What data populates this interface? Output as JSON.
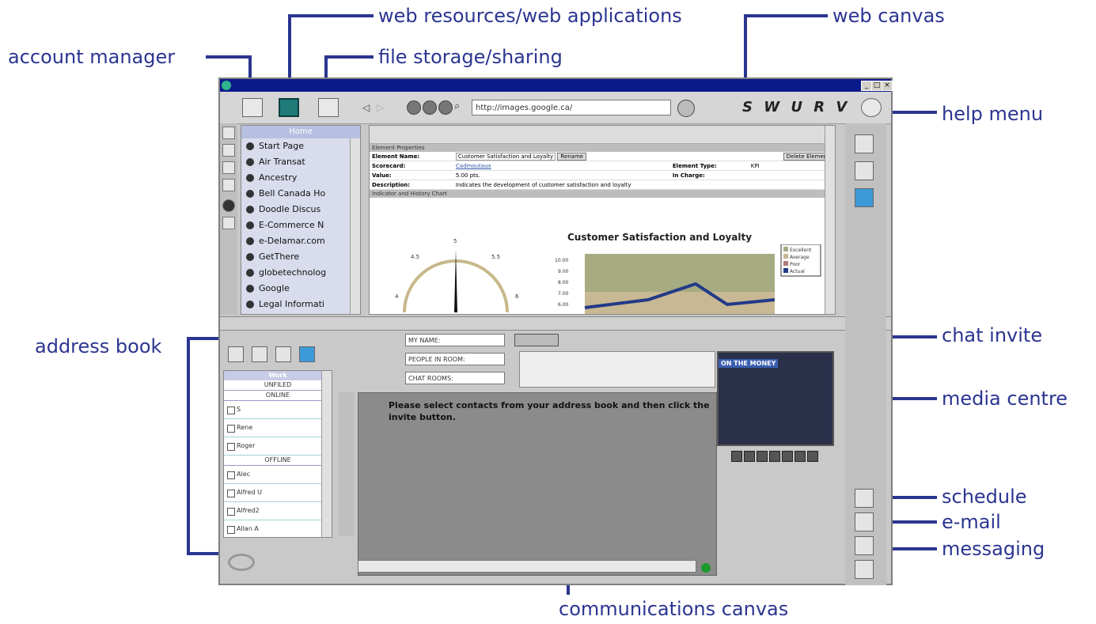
{
  "callouts": {
    "account_manager": "account manager",
    "web_resources": "web resources/web applications",
    "file_storage": "file storage/sharing",
    "web_canvas": "web canvas",
    "help_menu": "help menu",
    "address_book": "address book",
    "chat_invite": "chat invite",
    "media_centre": "media centre",
    "schedule": "schedule",
    "email": "e-mail",
    "messaging": "messaging",
    "communications_canvas": "communications canvas"
  },
  "toolbar": {
    "url": "http://images.google.ca/",
    "brand": "S W U R V"
  },
  "bookmarks": {
    "header": "Home",
    "items": [
      "Start Page",
      "Air Transat",
      "Ancestry",
      "Bell Canada Ho",
      "Doodle Discus",
      "E-Commerce N",
      "e-Delamar.com",
      "GetThere",
      "globetechnolog",
      "Google",
      "Legal Informati"
    ]
  },
  "element_properties": {
    "section_label": "Element Properties",
    "rows": [
      {
        "k1": "Element Name:",
        "v1": "Customer Satisfaction and Loyalty",
        "k2": "",
        "v2": ""
      },
      {
        "k1": "Scorecard:",
        "v1": "Cadmoutaux",
        "k2": "Element Type:",
        "v2": "KPI"
      },
      {
        "k1": "Value:",
        "v1": "5.00 pts.",
        "k2": "In Charge:",
        "v2": ""
      },
      {
        "k1": "Description:",
        "v1": "Indicates the development of customer satisfaction and loyalty",
        "k2": "",
        "v2": ""
      }
    ],
    "rename": "Rename",
    "delete": "Delete Element",
    "chart_section": "Indicator and History Chart",
    "gauge_labels": [
      "5",
      "4.5",
      "5.5",
      "4",
      "6"
    ],
    "chart_title": "Customer Satisfaction and Loyalty",
    "chart_legend": [
      "Excellent",
      "Average",
      "Poor",
      "Actual"
    ],
    "chart_ticks": [
      "10.00",
      "9.00",
      "8.00",
      "7.00",
      "6.00"
    ]
  },
  "address_book": {
    "header": "Work",
    "groups": {
      "unfiled": "UNFILED",
      "online": "ONLINE",
      "offline": "OFFLINE"
    },
    "online": [
      "S",
      "Rene",
      "Roger"
    ],
    "offline": [
      "Alec",
      "Alfred U",
      "Alfred2",
      "Allan A"
    ]
  },
  "chat": {
    "my_name": "MY NAME:",
    "people_in_room": "PEOPLE IN ROOM:",
    "chat_rooms": "CHAT ROOMS:",
    "message": "Please select contacts from your address book and then click the invite button."
  },
  "media": {
    "label": "ON THE MONEY"
  },
  "colors": {
    "callout": "#2b3590",
    "titlebar": "#0b1a8a",
    "status_dot": "#1a9a2a"
  }
}
